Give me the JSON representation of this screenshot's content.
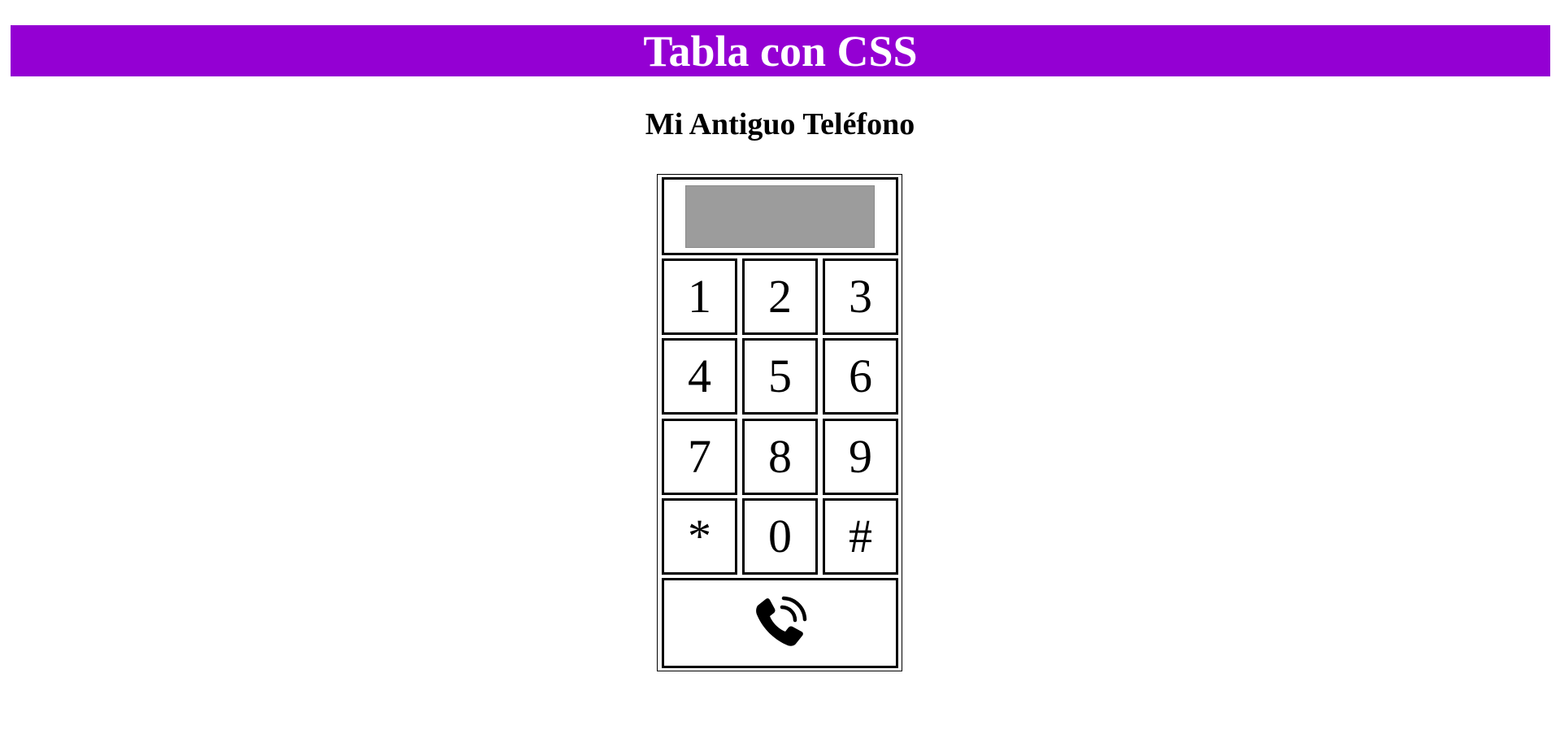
{
  "header": {
    "title": "Tabla con CSS",
    "background_color": "#9400d3",
    "text_color": "#ffffff"
  },
  "subtitle": "Mi Antiguo Teléfono",
  "phone": {
    "display_value": "",
    "display_color": "#9c9c9c",
    "keys": [
      [
        "1",
        "2",
        "3"
      ],
      [
        "4",
        "5",
        "6"
      ],
      [
        "7",
        "8",
        "9"
      ],
      [
        "*",
        "0",
        "#"
      ]
    ],
    "call_icon": "phone-call-icon"
  }
}
